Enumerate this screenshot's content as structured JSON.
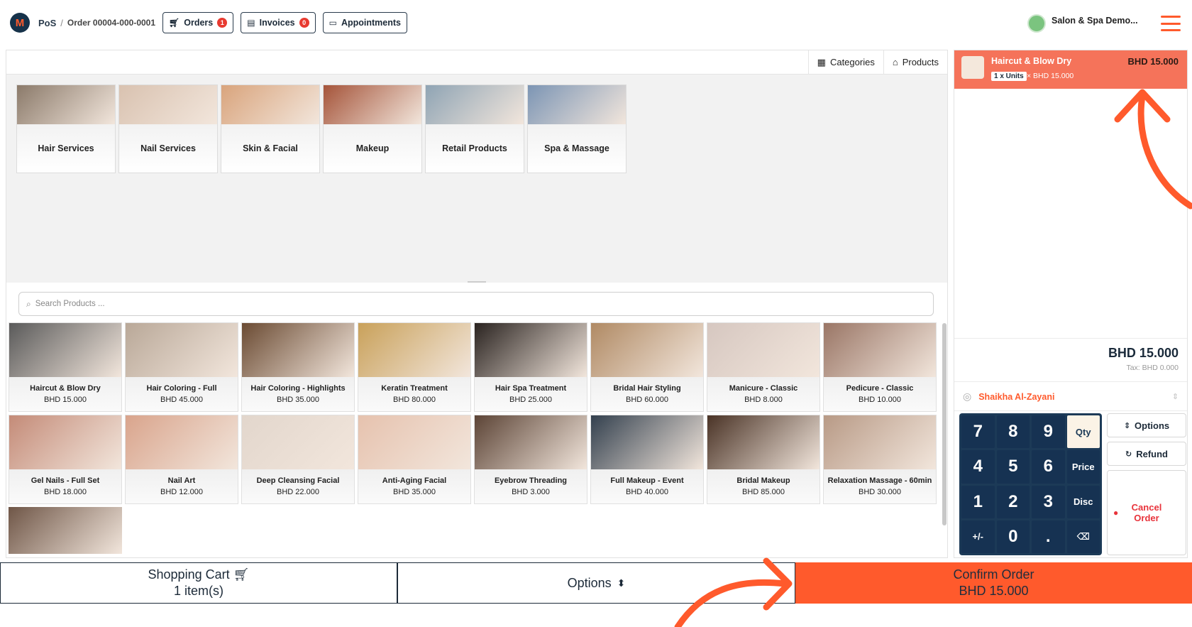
{
  "header": {
    "app_name": "PoS",
    "separator": "/",
    "order_label": "Order 00004-000-0001",
    "orders_label": "Orders",
    "orders_badge": "1",
    "invoices_label": "Invoices",
    "invoices_badge": "0",
    "appointments_label": "Appointments",
    "user_name": "Salon & Spa Demo..."
  },
  "view_tabs": {
    "categories": "Categories",
    "products": "Products"
  },
  "categories": [
    {
      "label": "Hair Services",
      "color": "#8b7a6a"
    },
    {
      "label": "Nail Services",
      "color": "#d9c2b0"
    },
    {
      "label": "Skin & Facial",
      "color": "#d9a47c"
    },
    {
      "label": "Makeup",
      "color": "#a5543a"
    },
    {
      "label": "Retail Products",
      "color": "#8fa4b4"
    },
    {
      "label": "Spa & Massage",
      "color": "#7c95b4"
    }
  ],
  "search": {
    "placeholder": "Search Products ..."
  },
  "products": [
    {
      "name": "Haircut & Blow Dry",
      "price": "BHD 15.000",
      "color": "#5a5a5a"
    },
    {
      "name": "Hair Coloring - Full",
      "price": "BHD 45.000",
      "color": "#b9a898"
    },
    {
      "name": "Hair Coloring - Highlights",
      "price": "BHD 35.000",
      "color": "#6b4b33"
    },
    {
      "name": "Keratin Treatment",
      "price": "BHD 80.000",
      "color": "#c9a15a"
    },
    {
      "name": "Hair Spa Treatment",
      "price": "BHD 25.000",
      "color": "#2a2320"
    },
    {
      "name": "Bridal Hair Styling",
      "price": "BHD 60.000",
      "color": "#b08a64"
    },
    {
      "name": "Manicure - Classic",
      "price": "BHD 8.000",
      "color": "#d6c7c0"
    },
    {
      "name": "Pedicure - Classic",
      "price": "BHD 10.000",
      "color": "#9a7666"
    },
    {
      "name": "Gel Nails - Full Set",
      "price": "BHD 18.000",
      "color": "#c48b78"
    },
    {
      "name": "Nail Art",
      "price": "BHD 12.000",
      "color": "#d9a48c"
    },
    {
      "name": "Deep Cleansing Facial",
      "price": "BHD 22.000",
      "color": "#e2d6cc"
    },
    {
      "name": "Anti-Aging Facial",
      "price": "BHD 35.000",
      "color": "#e6c2ae"
    },
    {
      "name": "Eyebrow Threading",
      "price": "BHD 3.000",
      "color": "#5c4436"
    },
    {
      "name": "Full Makeup - Event",
      "price": "BHD 40.000",
      "color": "#33404e"
    },
    {
      "name": "Bridal Makeup",
      "price": "BHD 85.000",
      "color": "#4a3326"
    },
    {
      "name": "Relaxation Massage - 60min",
      "price": "BHD 30.000",
      "color": "#b89a86"
    },
    {
      "name": "",
      "price": "",
      "color": "#6f5647"
    }
  ],
  "cart": {
    "item_name": "Haircut & Blow Dry",
    "item_total": "BHD 15.000",
    "units": "1 x Units",
    "unit_price": "× BHD 15.000",
    "total": "BHD 15.000",
    "tax": "Tax: BHD 0.000",
    "customer": "Shaikha Al-Zayani"
  },
  "numpad": {
    "keys": [
      "7",
      "8",
      "9",
      "Qty",
      "4",
      "5",
      "6",
      "Price",
      "1",
      "2",
      "3",
      "Disc",
      "+/-",
      "0",
      ".",
      "⌫"
    ]
  },
  "actions": {
    "options": "Options",
    "refund": "Refund",
    "cancel": "Cancel Order"
  },
  "bottom": {
    "cart_label": "Shopping Cart",
    "cart_count": "1 item(s)",
    "options_label": "Options",
    "confirm_label": "Confirm Order",
    "confirm_total": "BHD 15.000"
  },
  "colors": {
    "accent": "#ff5a2c",
    "navy": "#1c3a57",
    "cart_line": "#f5735a"
  }
}
